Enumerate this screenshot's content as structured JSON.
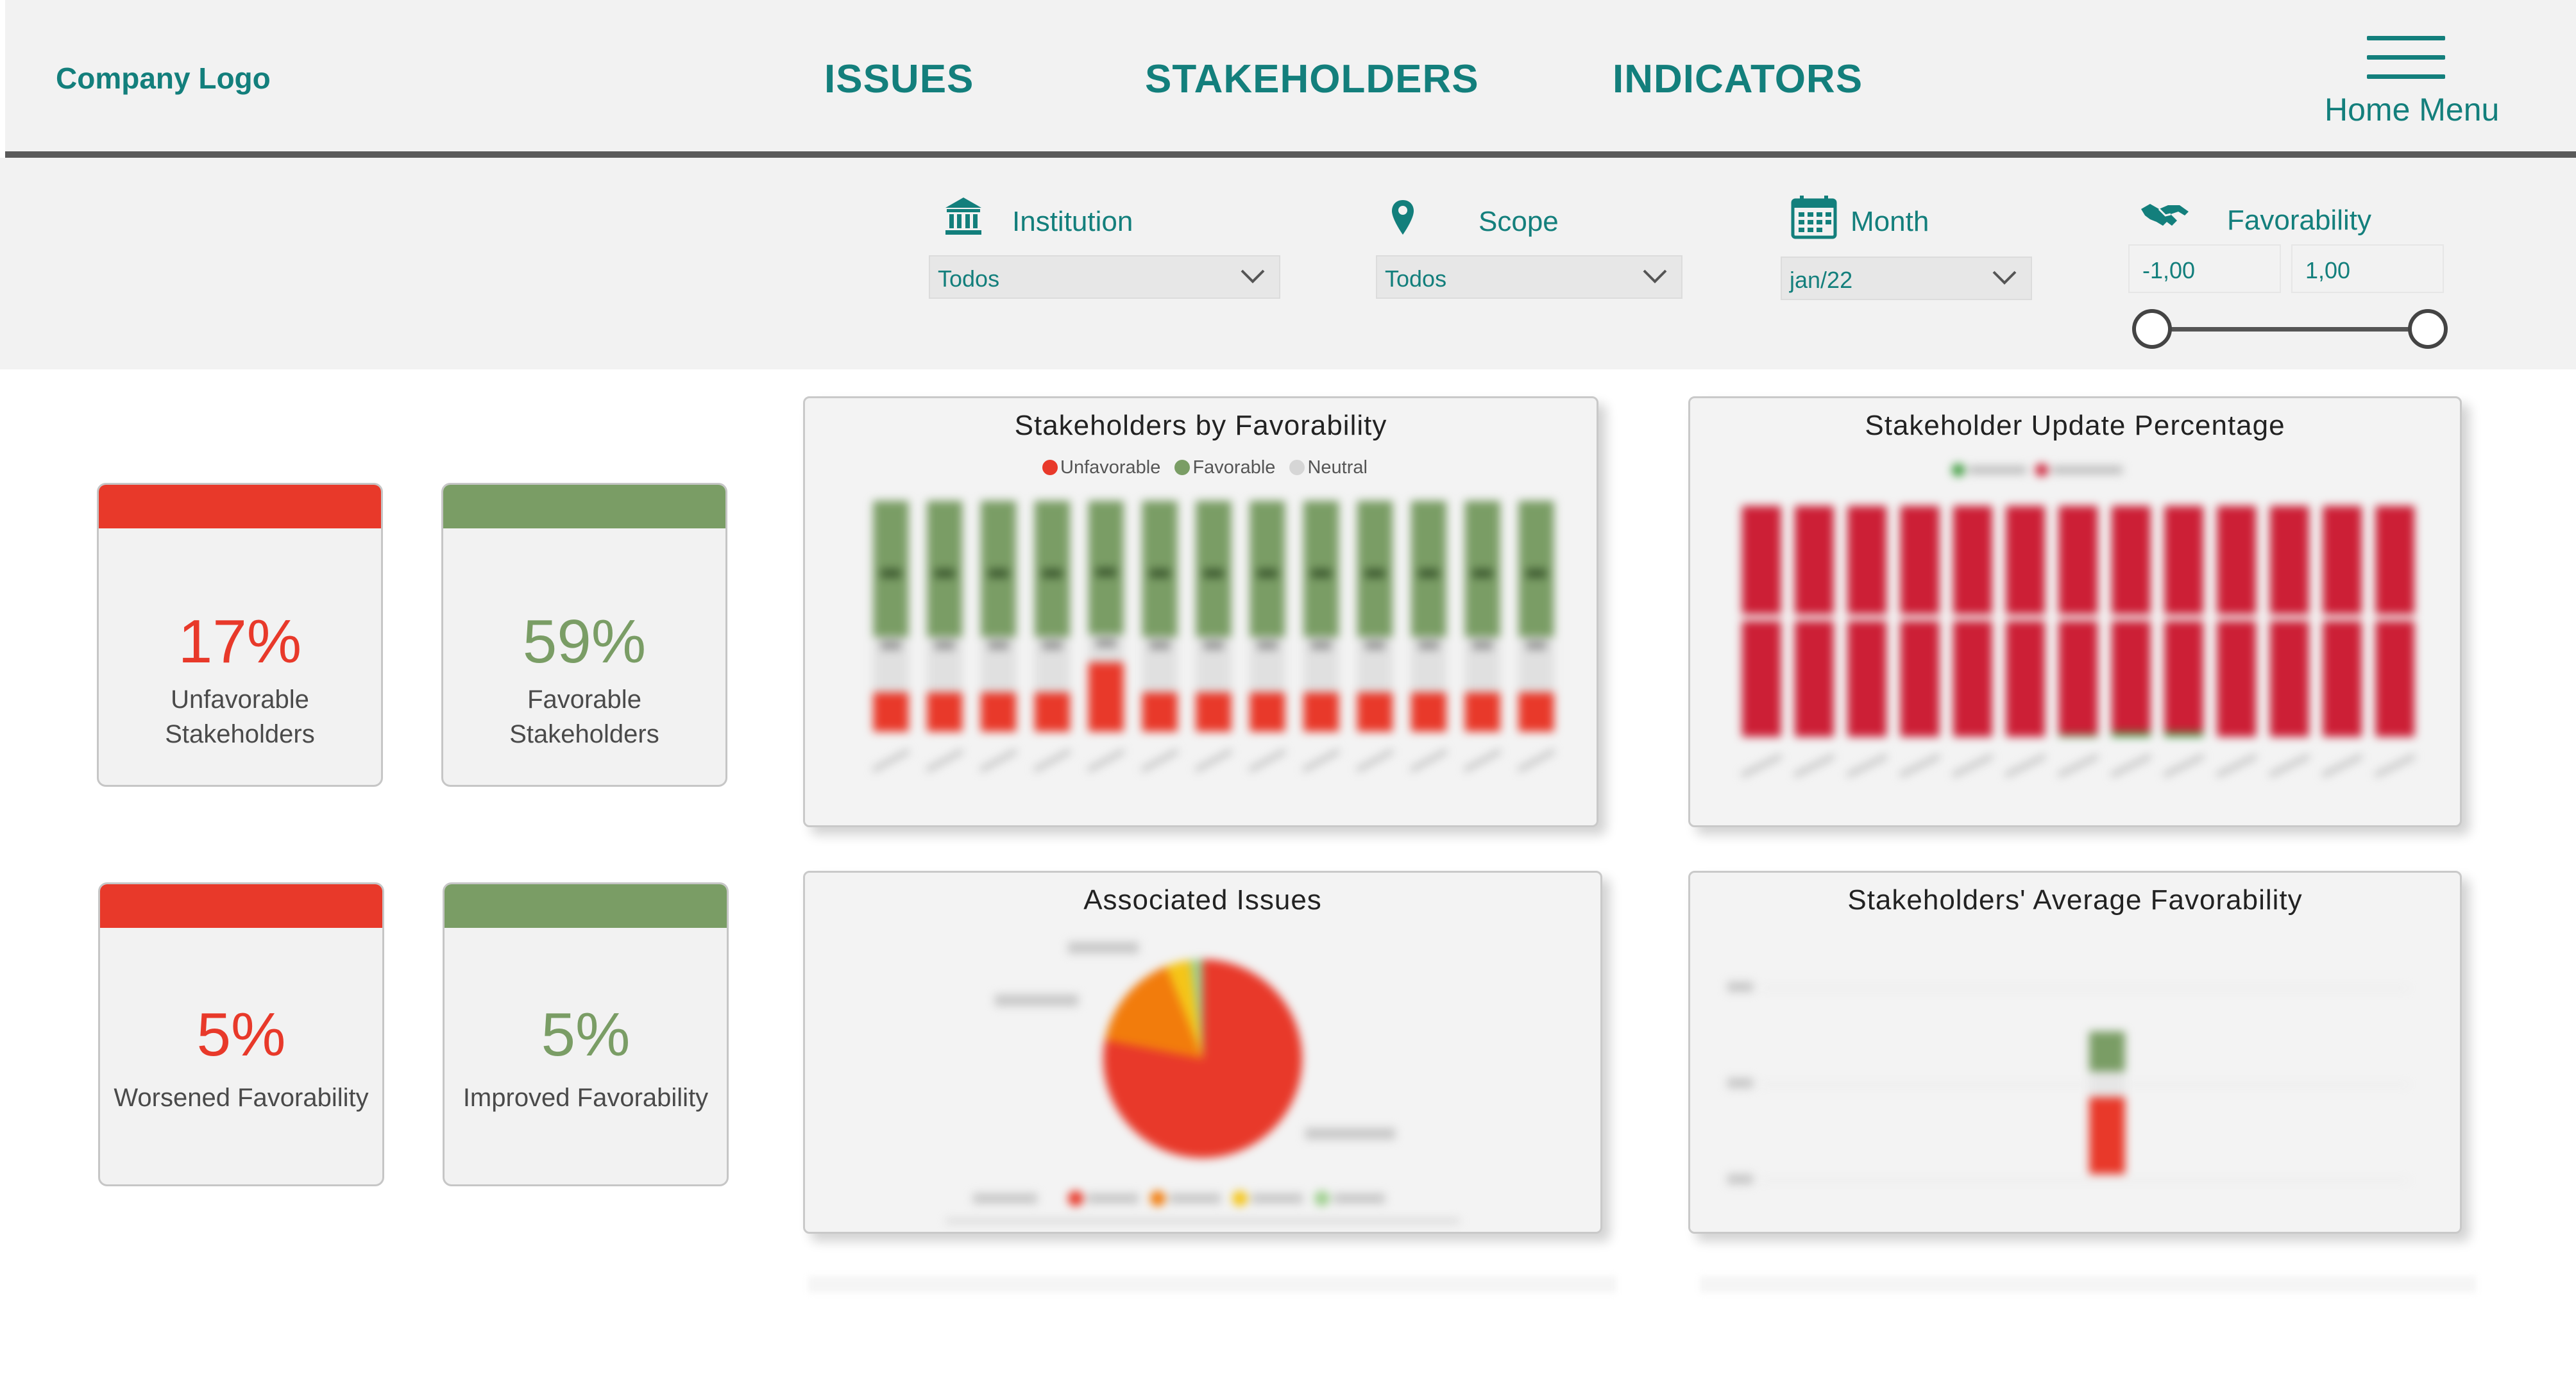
{
  "header": {
    "logo": "Company Logo",
    "nav": [
      {
        "label": "ISSUES"
      },
      {
        "label": "STAKEHOLDERS"
      },
      {
        "label": "INDICATORS"
      }
    ],
    "home_menu": {
      "label": "Home Menu",
      "icon": "hamburger-menu-icon"
    }
  },
  "filters": {
    "institution": {
      "label": "Institution",
      "value": "Todos",
      "icon": "institution-building-icon"
    },
    "scope": {
      "label": "Scope",
      "value": "Todos",
      "icon": "map-pin-icon"
    },
    "month": {
      "label": "Month",
      "value": "jan/22",
      "icon": "calendar-icon"
    },
    "favorability": {
      "label": "Favorability",
      "min": "-1,00",
      "max": "1,00",
      "icon": "handshake-icon"
    }
  },
  "kpis": [
    {
      "value": "17%",
      "label_line1": "Unfavorable",
      "label_line2": "Stakeholders",
      "tone": "negative"
    },
    {
      "value": "59%",
      "label_line1": "Favorable",
      "label_line2": "Stakeholders",
      "tone": "positive"
    },
    {
      "value": "5%",
      "label_line1": "Worsened Favorability",
      "label_line2": "",
      "tone": "negative"
    },
    {
      "value": "5%",
      "label_line1": "Improved Favorability",
      "label_line2": "",
      "tone": "positive"
    }
  ],
  "colors": {
    "accent": "#137f7c",
    "negative": "#e8392a",
    "positive": "#7a9d65",
    "header_bg": "#f2f2f2",
    "update_red": "#cc1f36",
    "update_green": "#3a9a3a",
    "pie_orange": "#f27c0c",
    "pie_yellow": "#f5c518"
  },
  "charts": {
    "favorability": {
      "title": "Stakeholders by Favorability",
      "legend": [
        "Unfavorable",
        "Favorable",
        "Neutral"
      ]
    },
    "update": {
      "title": "Stakeholder Update Percentage"
    },
    "issues": {
      "title": "Associated Issues"
    },
    "average": {
      "title": "Stakeholders' Average Favorability"
    }
  },
  "chart_data": [
    {
      "type": "bar",
      "title": "Stakeholders by Favorability",
      "stacked": true,
      "legend_position": "top",
      "series": [
        {
          "name": "Unfavorable",
          "values": [
            0.17,
            0.17,
            0.17,
            0.17,
            0.3,
            0.17,
            0.17,
            0.17,
            0.17,
            0.17,
            0.17,
            0.17,
            0.17
          ]
        },
        {
          "name": "Neutral",
          "values": [
            0.24,
            0.24,
            0.24,
            0.24,
            0.12,
            0.24,
            0.24,
            0.24,
            0.24,
            0.24,
            0.24,
            0.24,
            0.24
          ]
        },
        {
          "name": "Favorable",
          "values": [
            0.59,
            0.59,
            0.59,
            0.59,
            0.58,
            0.59,
            0.59,
            0.59,
            0.59,
            0.59,
            0.59,
            0.59,
            0.59
          ]
        }
      ]
    },
    {
      "type": "bar",
      "title": "Stakeholder Update Percentage",
      "stacked": true,
      "series": [
        {
          "values": [
            1,
            1,
            1,
            1,
            1,
            1,
            0.99,
            0.98,
            0.98,
            1,
            1,
            1,
            1
          ]
        },
        {
          "values": [
            0,
            0,
            0,
            0,
            0,
            0,
            0.01,
            0.02,
            0.02,
            0,
            0,
            0,
            0
          ]
        }
      ]
    },
    {
      "type": "pie",
      "title": "Associated Issues",
      "values": [
        0.78,
        0.16,
        0.04,
        0.02
      ]
    },
    {
      "type": "bar",
      "title": "Stakeholders' Average Favorability",
      "values": [
        0.35
      ],
      "ylim": [
        -1,
        1
      ]
    }
  ]
}
